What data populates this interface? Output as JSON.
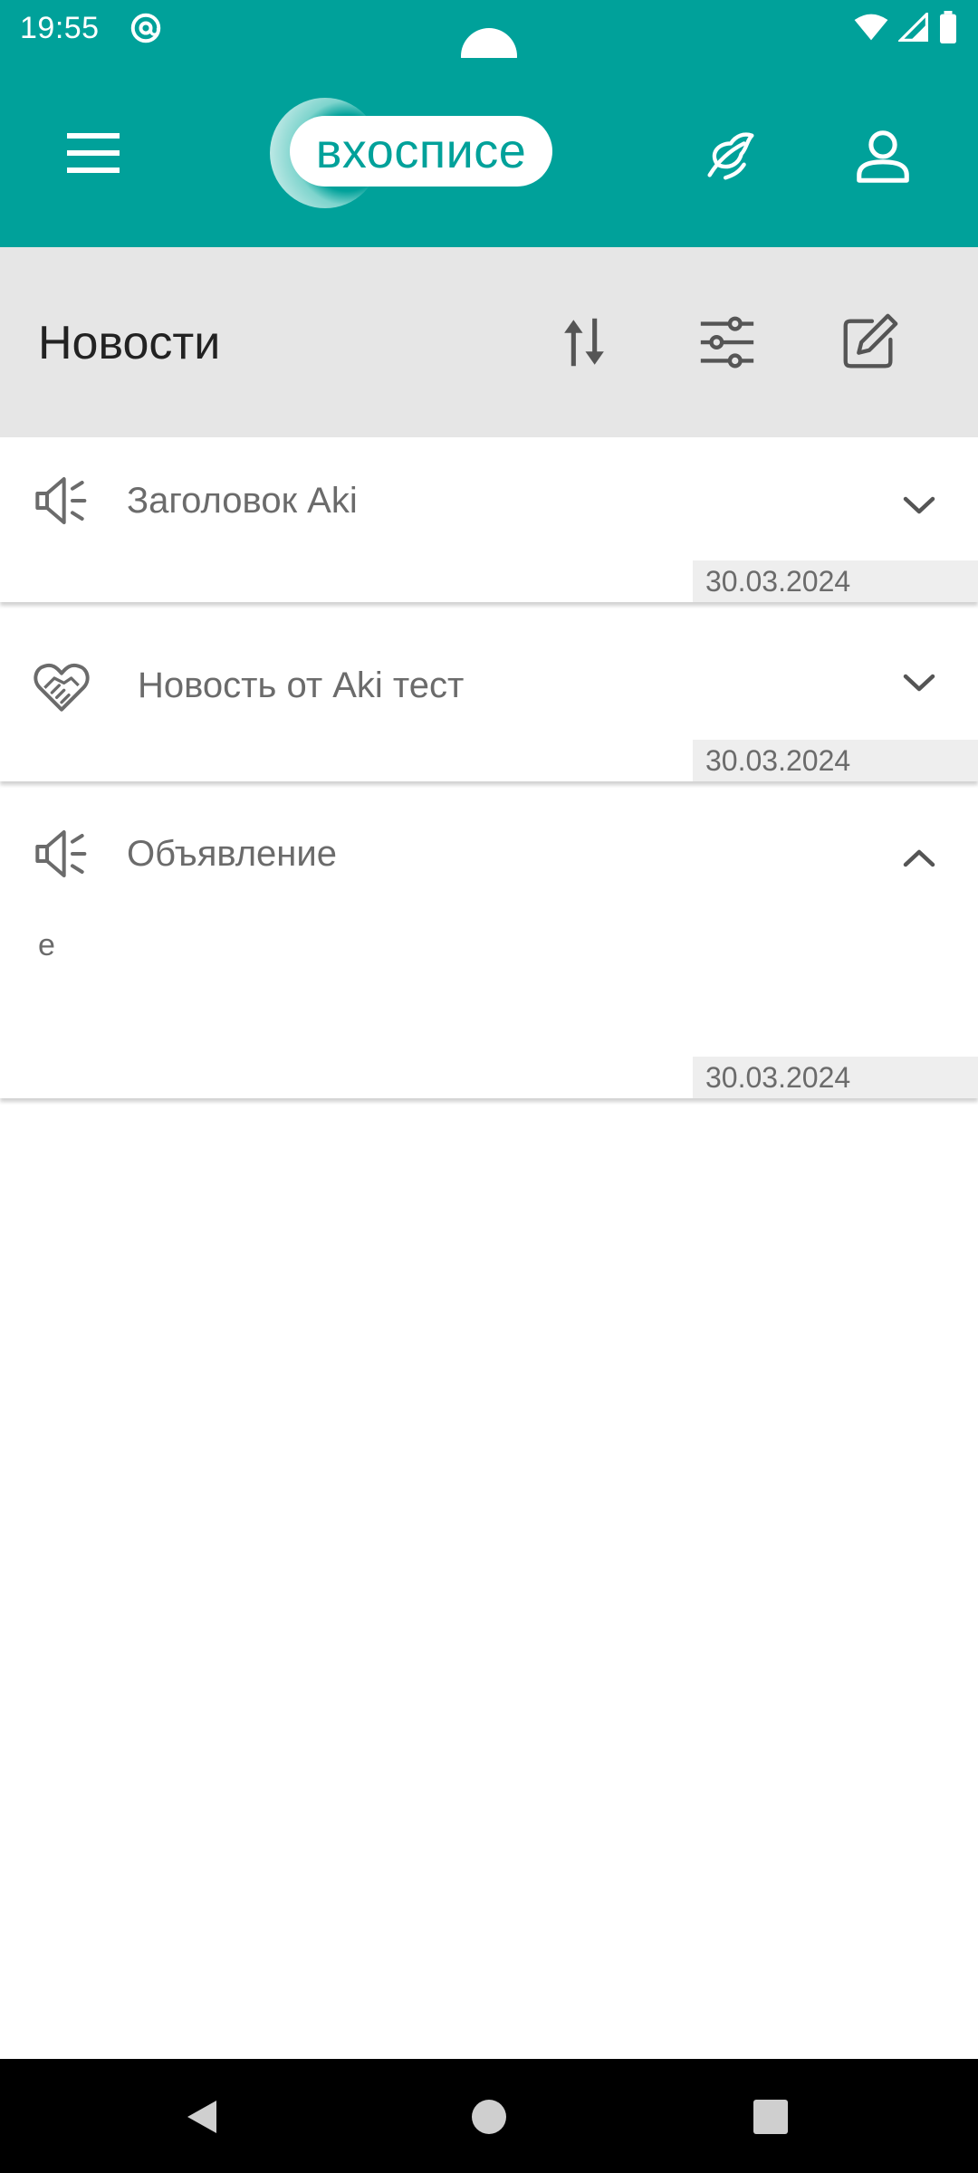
{
  "status_bar": {
    "time": "19:55"
  },
  "app_bar": {
    "logo_text": "вхосписе",
    "brand_color": "#00A19A"
  },
  "toolbar": {
    "title": "Новости"
  },
  "news": [
    {
      "title": "Заголовок Aki",
      "date": "30.03.2024",
      "icon": "megaphone-icon",
      "expanded": false,
      "body": ""
    },
    {
      "title": "Новость от Aki тест",
      "date": "30.03.2024",
      "icon": "handshake-heart-icon",
      "expanded": false,
      "body": ""
    },
    {
      "title": "Объявление",
      "date": "30.03.2024",
      "icon": "megaphone-icon",
      "expanded": true,
      "body": "е"
    }
  ],
  "icons": {
    "menu": "menu-icon",
    "leaf": "leaf-icon",
    "profile": "user-icon",
    "sort": "sort-icon",
    "filter": "filter-sliders-icon",
    "edit": "edit-icon"
  }
}
